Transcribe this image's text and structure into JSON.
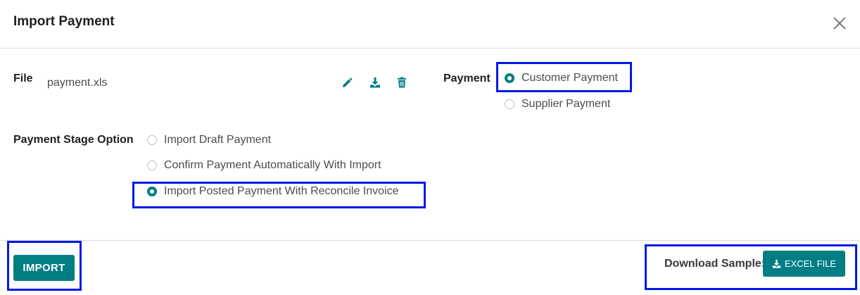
{
  "dialog": {
    "title": "Import Payment"
  },
  "file": {
    "label": "File",
    "filename": "payment.xls"
  },
  "payment": {
    "label": "Payment",
    "options": [
      {
        "label": "Customer Payment",
        "selected": true
      },
      {
        "label": "Supplier Payment",
        "selected": false
      }
    ]
  },
  "stage": {
    "label": "Payment Stage Option",
    "options": [
      {
        "label": "Import Draft Payment",
        "selected": false
      },
      {
        "label": "Confirm Payment Automatically With Import",
        "selected": false
      },
      {
        "label": "Import Posted Payment With Reconcile Invoice",
        "selected": true
      }
    ]
  },
  "footer": {
    "import_label": "IMPORT",
    "download_label": "Download Sample:",
    "excel_label": "EXCEL FILE"
  },
  "colors": {
    "accent": "#017e84",
    "highlight": "#0019e6"
  },
  "icons": [
    "close-icon",
    "pencil-icon",
    "download-icon",
    "trash-icon"
  ]
}
